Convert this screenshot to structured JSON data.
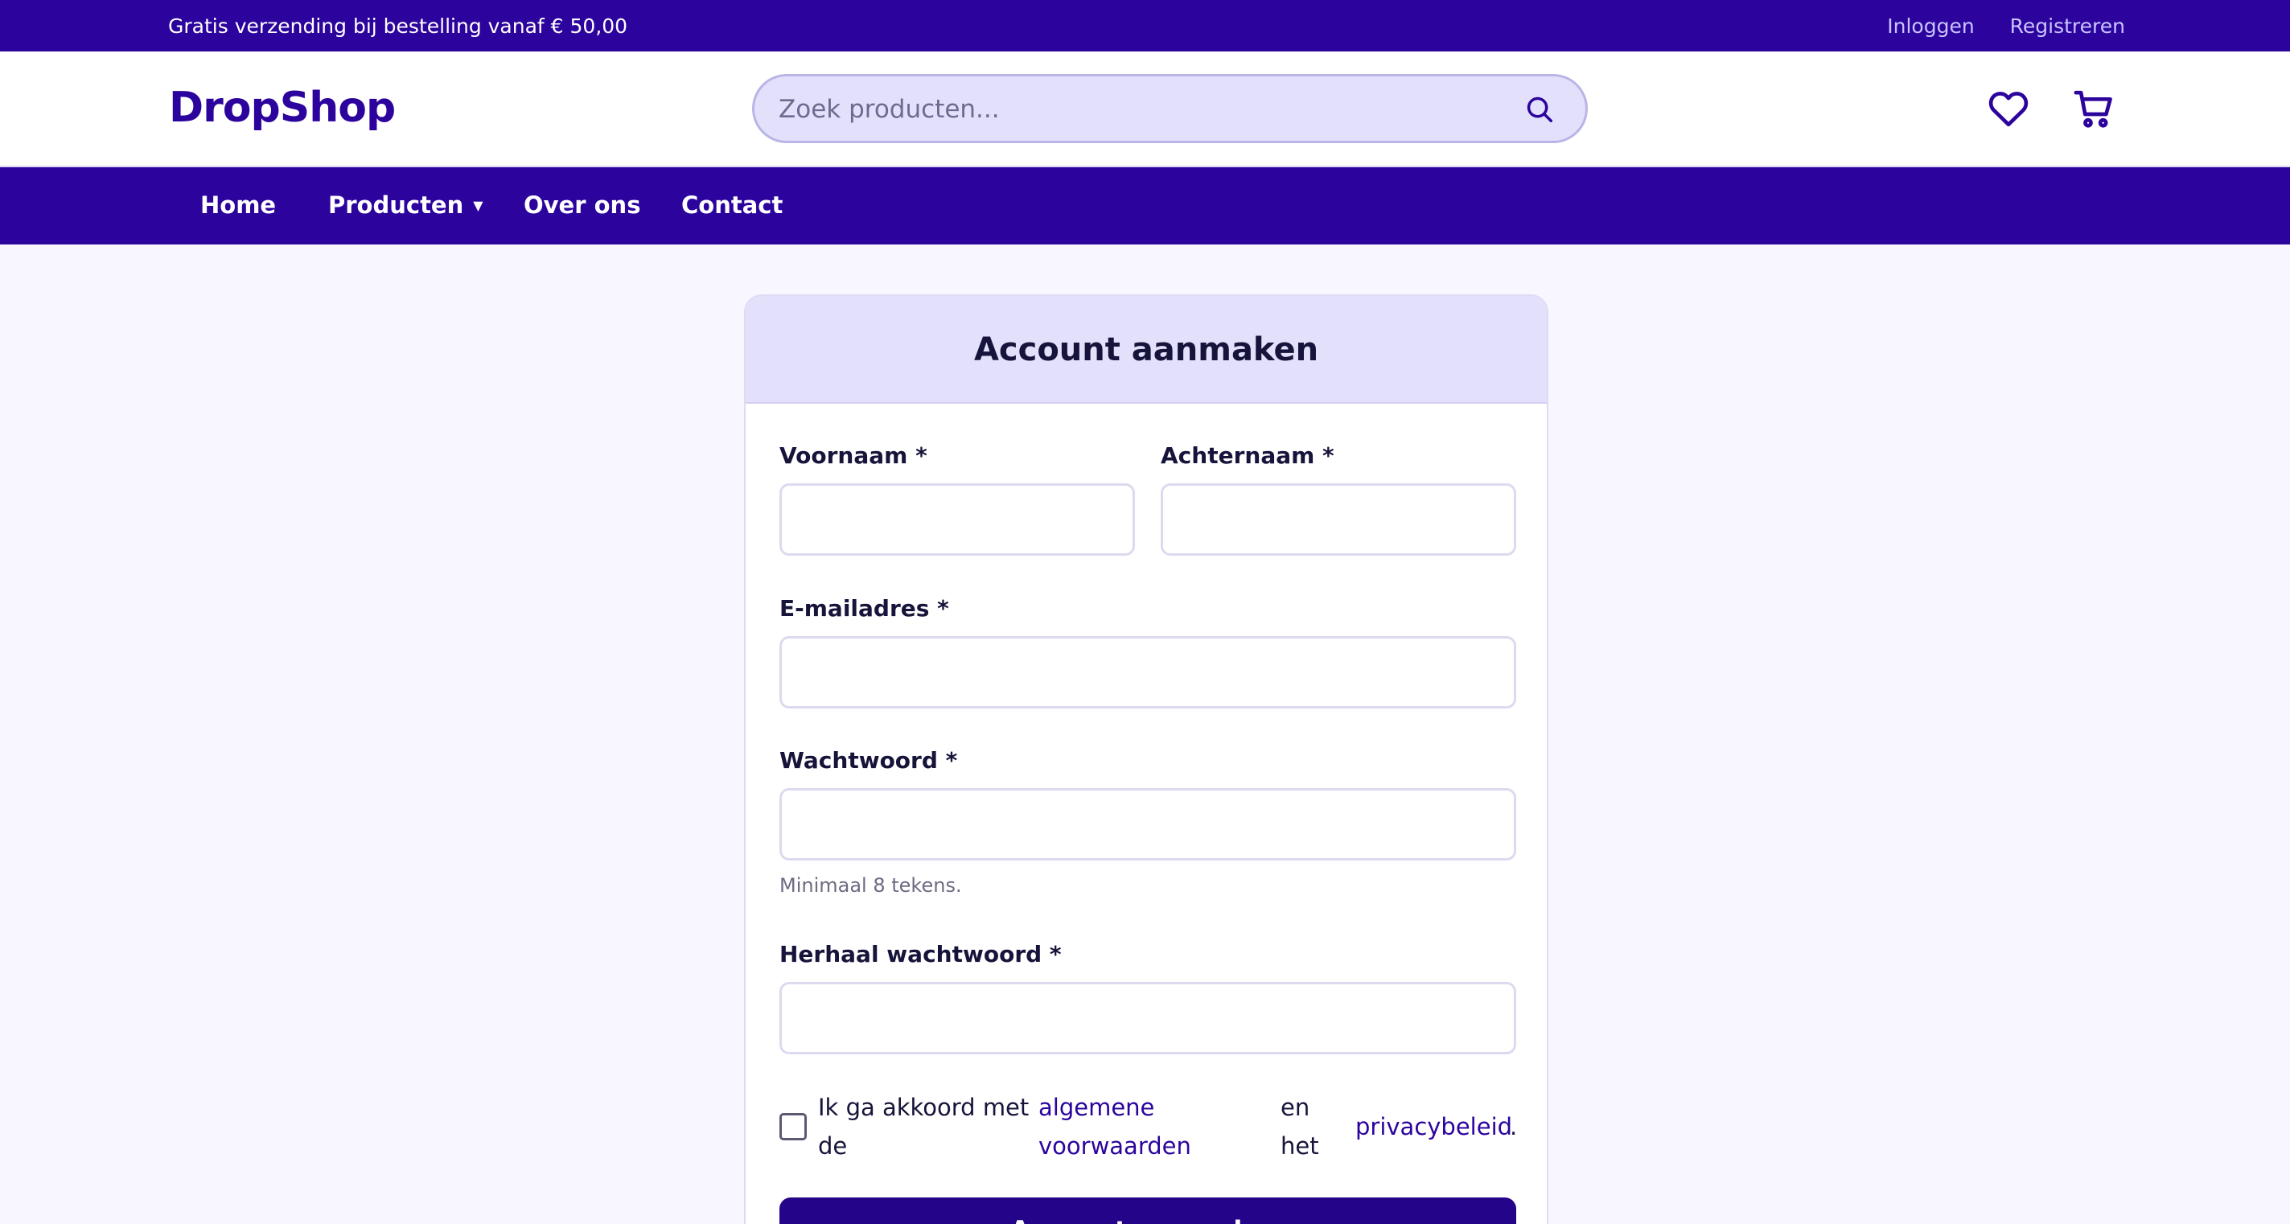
{
  "topbar": {
    "promo": "Gratis verzending bij bestelling vanaf € 50,00",
    "login": "Inloggen",
    "register": "Registreren"
  },
  "header": {
    "logo": "DropShop",
    "search_placeholder": "Zoek producten...",
    "icons": [
      "search-icon",
      "heart-icon",
      "cart-icon"
    ]
  },
  "nav": {
    "home": "Home",
    "products": "Producten",
    "about": "Over ons",
    "contact": "Contact"
  },
  "form": {
    "title": "Account aanmaken",
    "first_name_label": "Voornaam *",
    "last_name_label": "Achternaam *",
    "email_label": "E-mailadres *",
    "password_label": "Wachtwoord *",
    "password_hint": "Minimaal 8 tekens.",
    "repeat_password_label": "Herhaal wachtwoord *",
    "terms": {
      "agree_line1": "Ik ga akkoord met",
      "agree_line2": "de",
      "link1_line1": "algemene",
      "link1_line2": "voorwaarden",
      "and_line1": "en",
      "and_line2": "het",
      "link2": "privacybeleid",
      "period": "."
    },
    "submit_label": "Account aanmaken"
  },
  "colors": {
    "brand": "#2c049d",
    "button": "#240488",
    "header_tint": "#e2e0fb",
    "page_bg": "#f8f7ff"
  }
}
